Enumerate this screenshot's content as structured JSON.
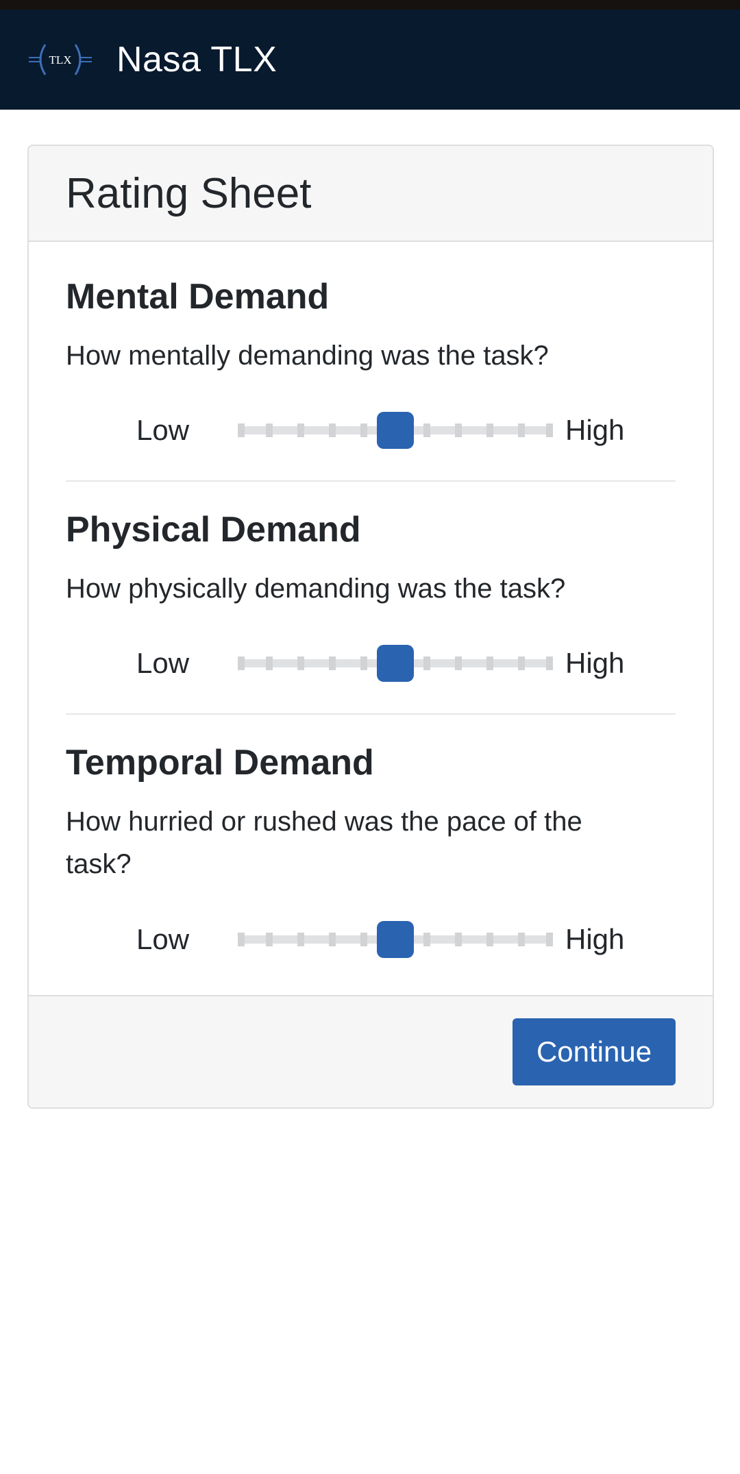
{
  "header": {
    "logo_text": "TLX",
    "title": "Nasa TLX"
  },
  "card": {
    "title": "Rating Sheet",
    "questions": [
      {
        "title": "Mental Demand",
        "text": "How mentally demanding was the task?",
        "low_label": "Low",
        "high_label": "High",
        "value": 50
      },
      {
        "title": "Physical Demand",
        "text": "How physically demanding was the task?",
        "low_label": "Low",
        "high_label": "High",
        "value": 50
      },
      {
        "title": "Temporal Demand",
        "text": "How hurried or rushed was the pace of the task?",
        "low_label": "Low",
        "high_label": "High",
        "value": 50
      }
    ],
    "continue_label": "Continue"
  },
  "colors": {
    "navbar": "#081a2e",
    "accent": "#2a63b0",
    "track": "#e0e1e3"
  }
}
